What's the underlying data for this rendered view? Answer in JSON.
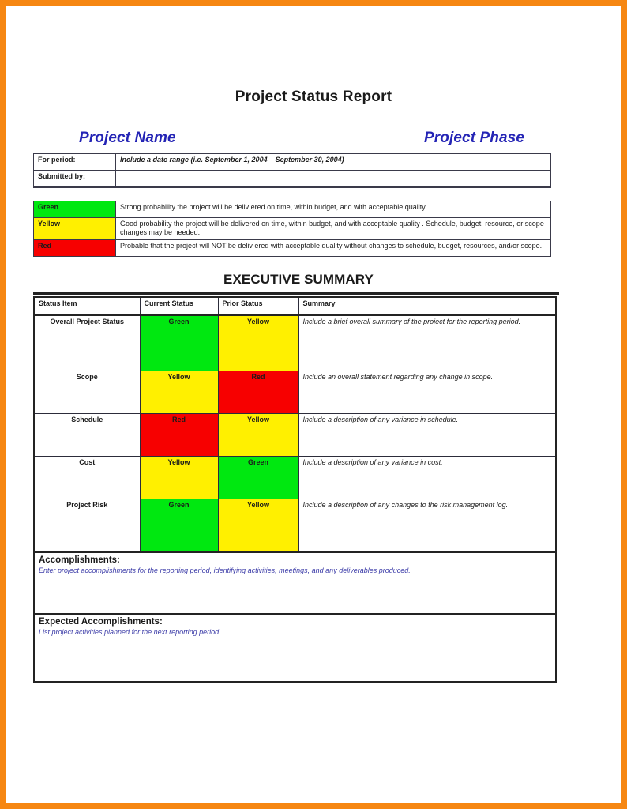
{
  "document": {
    "title": "Project Status Report",
    "project_name_heading": "Project Name",
    "project_phase_heading": "Project Phase",
    "section_title": "EXECUTIVE SUMMARY"
  },
  "colors": {
    "page_border": "#f68712",
    "heading_blue": "#2424b5",
    "placeholder_blue": "#3c3ca8",
    "status_green": "#00e810",
    "status_yellow": "#fff000",
    "status_red": "#f70000"
  },
  "header_table": {
    "for_period_label": "For period:",
    "for_period_value": "Include a date range (i.e. September 1, 2004 – September 30, 2004)",
    "submitted_by_label": "Submitted by:",
    "submitted_by_value": "",
    "legend": [
      {
        "label": "Green",
        "color": "#00e810",
        "description": "Strong probability  the project will be deliv ered on time, within budget, and with acceptable quality."
      },
      {
        "label": "Yellow",
        "color": "#fff000",
        "description": "Good probability the project will be delivered on time, within budget, and with acceptable quality . Schedule, budget, resource, or scope changes may be needed."
      },
      {
        "label": "Red",
        "color": "#f70000",
        "description": "Probable that the project will NOT be deliv ered with acceptable quality without changes to schedule, budget, resources, and/or scope."
      }
    ]
  },
  "exec_summary": {
    "columns": [
      "Status Item",
      "Current Status",
      "Prior Status",
      "Summary"
    ],
    "rows": [
      {
        "item": "Overall Project Status",
        "current": "Green",
        "current_color": "green",
        "prior": "Yellow",
        "prior_color": "yellow",
        "summary": "Include a brief overall summary of the project for the reporting period."
      },
      {
        "item": "Scope",
        "current": "Yellow",
        "current_color": "yellow",
        "prior": "Red",
        "prior_color": "red",
        "summary": "Include an overall statement regarding any change in scope."
      },
      {
        "item": "Schedule",
        "current": "Red",
        "current_color": "red",
        "prior": "Yellow",
        "prior_color": "yellow",
        "summary": "Include a description of any variance in schedule."
      },
      {
        "item": "Cost",
        "current": "Yellow",
        "current_color": "yellow",
        "prior": "Green",
        "prior_color": "green",
        "summary": "Include a description of any variance in cost."
      },
      {
        "item": "Project Risk",
        "current": "Green",
        "current_color": "green",
        "prior": "Yellow",
        "prior_color": "yellow",
        "summary": "Include a description of any changes to the risk management log."
      }
    ],
    "accomplishments": {
      "title": "Accomplishments:",
      "body": "Enter project accomplishments for the reporting period, identifying activities, meetings, and any deliverables produced."
    },
    "expected_accomplishments": {
      "title": "Expected Accomplishments:",
      "body": "List project activities planned for the next reporting period."
    }
  }
}
